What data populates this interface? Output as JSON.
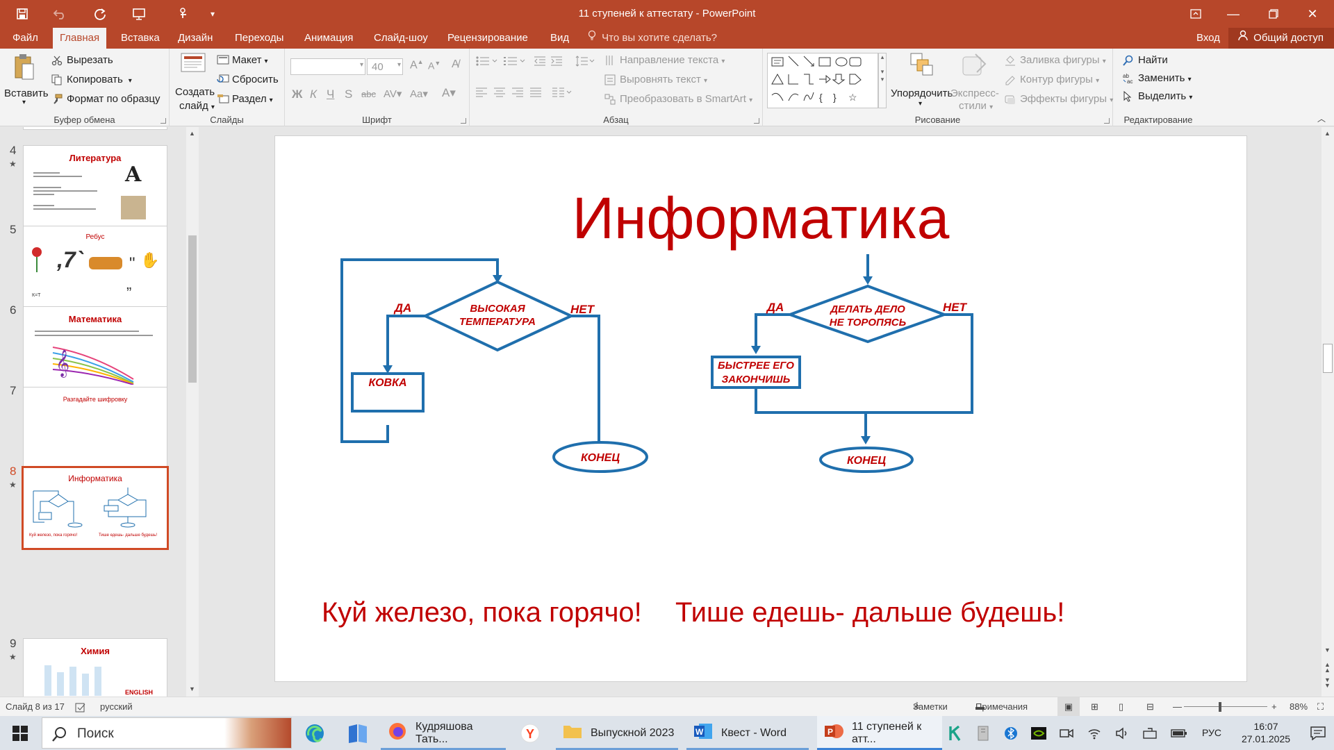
{
  "window": {
    "title": "11 ступеней к аттестату - PowerPoint"
  },
  "menu": {
    "tabs": [
      "Файл",
      "Главная",
      "Вставка",
      "Дизайн",
      "Переходы",
      "Анимация",
      "Слайд-шоу",
      "Рецензирование",
      "Вид"
    ],
    "active_tab": "Главная",
    "tell_me": "Что вы хотите сделать?",
    "login": "Вход",
    "share": "Общий доступ"
  },
  "ribbon": {
    "clipboard": {
      "paste": "Вставить",
      "cut": "Вырезать",
      "copy": "Копировать",
      "format_painter": "Формат по образцу",
      "label": "Буфер обмена"
    },
    "slides": {
      "new_slide_line1": "Создать",
      "new_slide_line2": "слайд",
      "layout": "Макет",
      "reset": "Сбросить",
      "section": "Раздел",
      "label": "Слайды"
    },
    "font": {
      "size": "40",
      "label": "Шрифт"
    },
    "paragraph": {
      "text_direction": "Направление текста",
      "align_text": "Выровнять текст",
      "smartart": "Преобразовать в SmartArt",
      "label": "Абзац"
    },
    "drawing": {
      "arrange": "Упорядочить",
      "quick_styles_line1": "Экспресс-",
      "quick_styles_line2": "стили",
      "shape_fill": "Заливка фигуры",
      "shape_outline": "Контур фигуры",
      "shape_effects": "Эффекты фигуры",
      "label": "Рисование"
    },
    "editing": {
      "find": "Найти",
      "replace": "Заменить",
      "select": "Выделить",
      "label": "Редактирование"
    }
  },
  "thumbnails": [
    {
      "num": "4",
      "title": "Литература",
      "starred": true
    },
    {
      "num": "5",
      "title": "Ребус",
      "starred": false,
      "caption": "К=Т"
    },
    {
      "num": "6",
      "title": "Математика",
      "starred": false
    },
    {
      "num": "7",
      "title": "Разгадайте шифровку",
      "starred": false
    },
    {
      "num": "8",
      "title": "Информатика",
      "starred": true,
      "selected": true,
      "left_caption": "Куй железо, пока горячо!",
      "right_caption": "Тише едешь- дальше будешь!"
    },
    {
      "num": "9",
      "title": "Химия",
      "starred": true,
      "caption": "ENGLISH"
    }
  ],
  "slide": {
    "title": "Информатика",
    "left_flow": {
      "yes": "ДА",
      "no": "НЕТ",
      "decision_line1": "ВЫСОКАЯ",
      "decision_line2": "ТЕМПЕРАТУРА",
      "action": "КОВКА",
      "end": "КОНЕЦ"
    },
    "right_flow": {
      "yes": "ДА",
      "no": "НЕТ",
      "decision_line1": "ДЕЛАТЬ ДЕЛО",
      "decision_line2": "НЕ ТОРОПЯСЬ",
      "action_line1": "БЫСТРЕЕ ЕГО",
      "action_line2": "ЗАКОНЧИШЬ",
      "end": "КОНЕЦ"
    },
    "left_proverb": "Куй железо, пока горячо!",
    "right_proverb": "Тише едешь- дальше будешь!",
    "accent_color": "#c00000",
    "flow_color": "#1f6fad"
  },
  "statusbar": {
    "slide_info": "Слайд 8 из 17",
    "language": "русский",
    "notes": "Заметки",
    "comments": "Примечания",
    "zoom": "88%"
  },
  "taskbar": {
    "search": "Поиск",
    "apps": [
      {
        "label": "Кудряшова Тать...",
        "icon": "firefox-icon"
      },
      {
        "label": "Выпускной 2023",
        "icon": "folder-icon"
      },
      {
        "label": "Квест - Word",
        "icon": "word-icon"
      },
      {
        "label": "11 ступеней к атт...",
        "icon": "powerpoint-icon"
      }
    ],
    "lang": "РУС",
    "time": "16:07",
    "date": "27.01.2025"
  }
}
